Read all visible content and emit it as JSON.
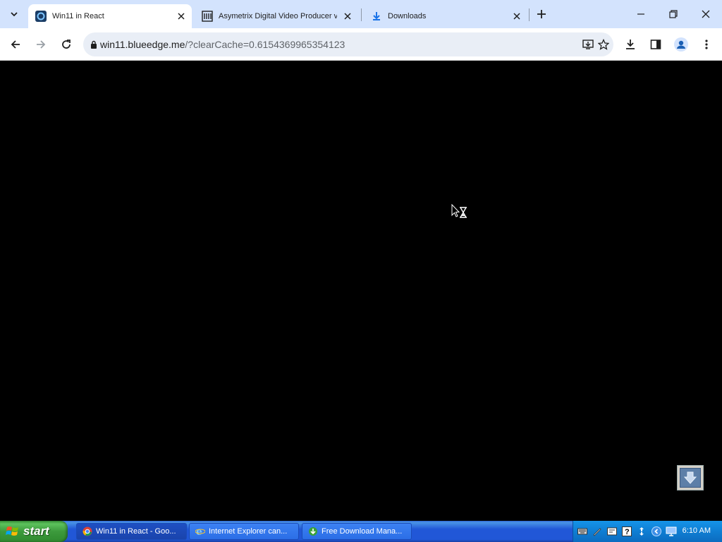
{
  "browser": {
    "tabs": [
      {
        "title": "Win11 in React",
        "active": true
      },
      {
        "title": "Asymetrix Digital Video Producer v",
        "active": false
      },
      {
        "title": "Downloads",
        "active": false
      }
    ],
    "url_host": "win11.blueedge.me",
    "url_rest": "/?clearCache=0.6154369965354123"
  },
  "taskbar": {
    "start_label": "start",
    "items": [
      {
        "label": "Win11 in React - Goo..."
      },
      {
        "label": "Internet Explorer can..."
      },
      {
        "label": "Free Download Mana..."
      }
    ],
    "clock": "6:10 AM"
  },
  "colors": {
    "tabstrip_bg": "#d3e3fd",
    "page_bg": "#000000",
    "taskbar_blue": "#2157d7",
    "start_green": "#3c9a3c"
  }
}
